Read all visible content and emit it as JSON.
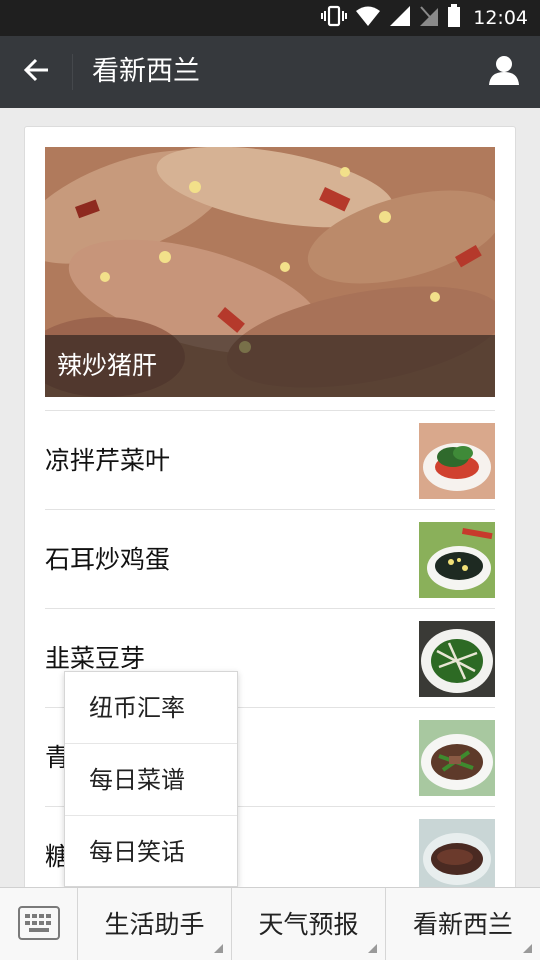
{
  "status_bar": {
    "time": "12:04"
  },
  "header": {
    "title": "看新西兰"
  },
  "article": {
    "cover_title": "辣炒猪肝",
    "items": [
      {
        "title": "凉拌芹菜叶"
      },
      {
        "title": "石耳炒鸡蛋"
      },
      {
        "title": "韭菜豆芽"
      },
      {
        "title": "青"
      },
      {
        "title": "糖"
      }
    ]
  },
  "popup_menu": {
    "items": [
      {
        "label": "纽币汇率"
      },
      {
        "label": "每日菜谱"
      },
      {
        "label": "每日笑话"
      }
    ]
  },
  "bottom_menu": {
    "buttons": [
      {
        "label": "生活助手"
      },
      {
        "label": "天气预报"
      },
      {
        "label": "看新西兰"
      }
    ]
  },
  "colors": {
    "title_bar": "#36393d",
    "status_bar": "#1f1f1f"
  },
  "icons": [
    "vibrate-icon",
    "wifi-icon",
    "signal-icon",
    "no-sim-icon",
    "battery-icon",
    "back-arrow-icon",
    "person-icon",
    "keyboard-icon"
  ]
}
